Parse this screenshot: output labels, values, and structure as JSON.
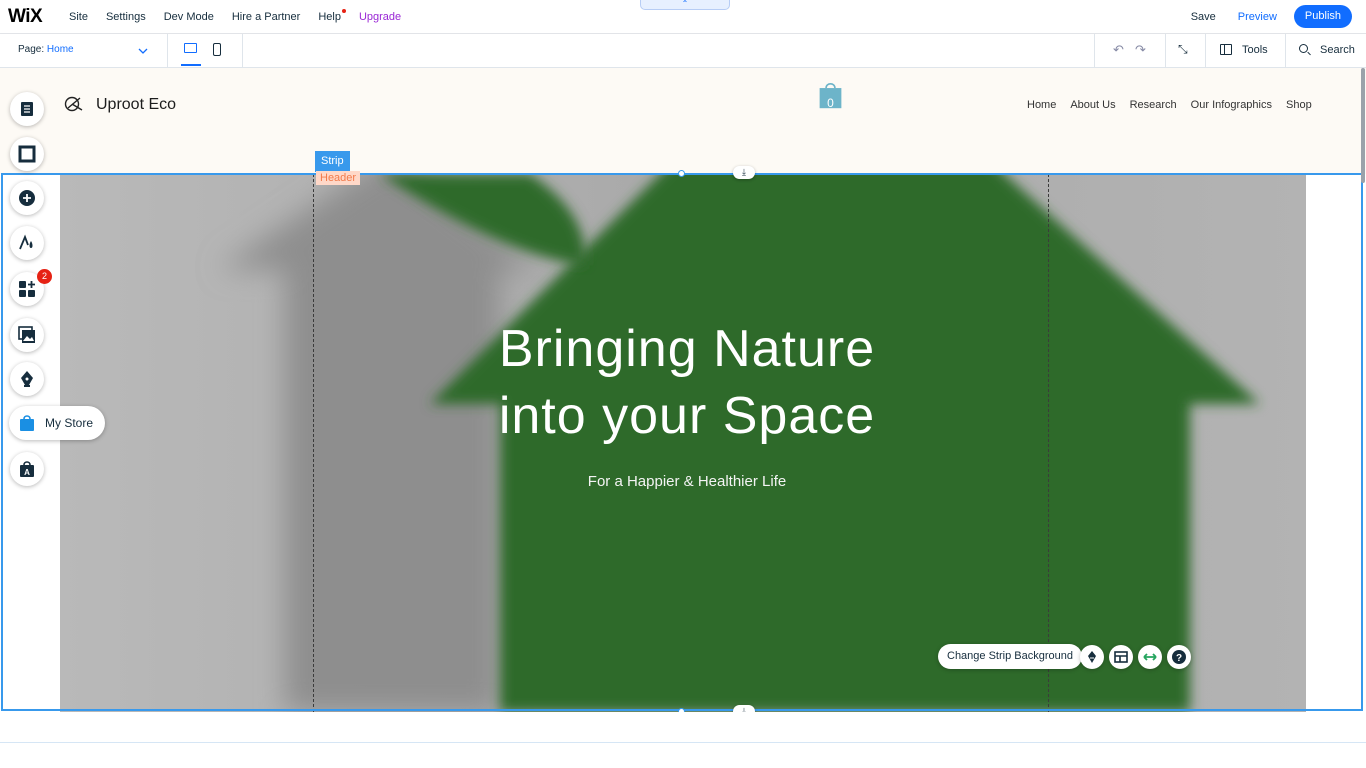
{
  "topbar": {
    "logo": "WiX",
    "menu": [
      "Site",
      "Settings",
      "Dev Mode",
      "Hire a Partner",
      "Help",
      "Upgrade"
    ],
    "collapse_glyph": "⌃",
    "save": "Save",
    "preview": "Preview",
    "publish": "Publish"
  },
  "secondbar": {
    "page_label": "Page:",
    "page_value": "Home",
    "tools": "Tools",
    "search": "Search"
  },
  "site": {
    "brand": "Uproot Eco",
    "cart_count": "0",
    "nav": [
      "Home",
      "About Us",
      "Research",
      "Our Infographics",
      "Shop"
    ],
    "hero_title_line1": "Bringing Nature",
    "hero_title_line2": "into your Space",
    "hero_subtitle": "For a Happier & Healthier Life"
  },
  "editor": {
    "strip_tag": "Strip",
    "header_tag": "Header",
    "change_strip_bg": "Change Strip Background"
  },
  "rail": {
    "add_apps_badge": "2",
    "my_store": "My Store"
  },
  "colors": {
    "accent": "#116dff",
    "selection": "#3899ec",
    "upgrade": "#9a27d5",
    "hero_green": "#2f6b2c"
  }
}
